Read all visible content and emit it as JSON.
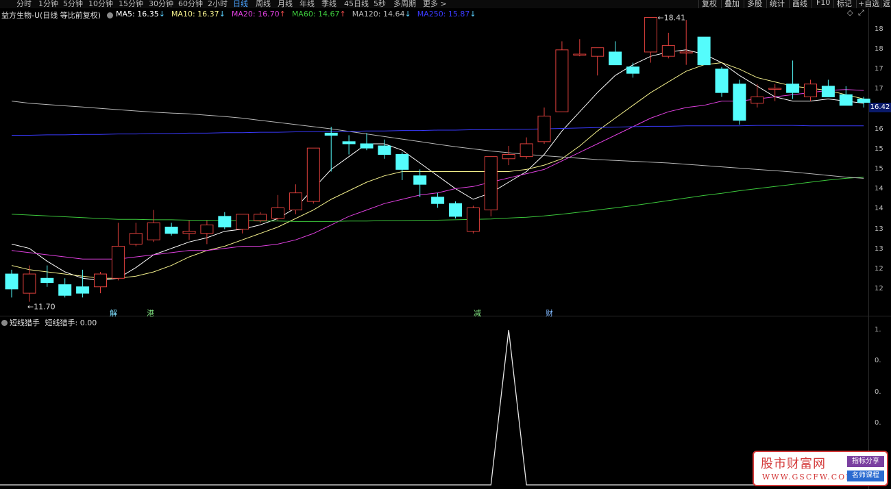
{
  "toolbar": {
    "periods": [
      "分时",
      "1分钟",
      "5分钟",
      "10分钟",
      "15分钟",
      "30分钟",
      "60分钟",
      "2小时",
      "日线",
      "周线",
      "月线",
      "年线",
      "季线",
      "45日线",
      "5秒",
      "多周期",
      "更多 >"
    ],
    "active_period": "日线",
    "right_buttons": [
      "复权",
      "叠加",
      "多股",
      "统计",
      "画线",
      "F10",
      "标记",
      "+自选",
      "返"
    ]
  },
  "main_legend": {
    "title": "益方生物-U(日线 等比前复权)",
    "items": [
      {
        "label": "MA5: 16.35",
        "arrow": "↓",
        "color": "#ffffff"
      },
      {
        "label": "MA10: 16.37",
        "arrow": "↓",
        "color": "#f4f08c"
      },
      {
        "label": "MA20: 16.70",
        "arrow": "↑",
        "color": "#e040e0"
      },
      {
        "label": "MA60: 14.67",
        "arrow": "↑",
        "color": "#3cc83c"
      },
      {
        "label": "MA120: 14.64",
        "arrow": "↓",
        "color": "#b8b8b8"
      },
      {
        "label": "MA250: 15.87",
        "arrow": "↓",
        "color": "#3a3aff"
      }
    ]
  },
  "sub_legend": {
    "title": "短线猎手",
    "value_label": "短线猎手: 0.00"
  },
  "price_axis_labels": [
    "18",
    "18",
    "17",
    "17",
    "16",
    "16",
    "15",
    "15",
    "14",
    "14",
    "13",
    "13",
    "12",
    "12"
  ],
  "sub_axis_labels": [
    "1.",
    "0.",
    "0.",
    "0."
  ],
  "current_price": "16.42",
  "events": [
    {
      "text": "解",
      "color": "#7fe0ff"
    },
    {
      "text": "港",
      "color": "#7fe07f"
    },
    {
      "text": "减",
      "color": "#7fe07f"
    },
    {
      "text": "财",
      "color": "#7fb8ff"
    }
  ],
  "watermark": {
    "title": "股市财富网",
    "url": "WWW.GSCFW.COM",
    "badge1": "指标分享",
    "badge2": "名师课程"
  },
  "chart_data": {
    "type": "candlestick",
    "ylim": [
      11.5,
      18.5
    ],
    "high_label": "18.41",
    "low_label": "11.70",
    "candles": [
      {
        "o": 12.4,
        "h": 12.5,
        "l": 11.85,
        "c": 12.05
      },
      {
        "o": 11.95,
        "h": 12.6,
        "l": 11.75,
        "c": 12.4
      },
      {
        "o": 12.3,
        "h": 12.6,
        "l": 12.1,
        "c": 12.2
      },
      {
        "o": 12.15,
        "h": 12.3,
        "l": 11.85,
        "c": 11.9
      },
      {
        "o": 12.1,
        "h": 12.5,
        "l": 11.85,
        "c": 11.95
      },
      {
        "o": 12.1,
        "h": 12.45,
        "l": 11.95,
        "c": 12.4
      },
      {
        "o": 12.3,
        "h": 13.6,
        "l": 12.25,
        "c": 13.05
      },
      {
        "o": 13.1,
        "h": 13.6,
        "l": 13.05,
        "c": 13.35
      },
      {
        "o": 13.2,
        "h": 13.9,
        "l": 13.15,
        "c": 13.6
      },
      {
        "o": 13.5,
        "h": 13.6,
        "l": 13.3,
        "c": 13.35
      },
      {
        "o": 13.35,
        "h": 13.65,
        "l": 13.2,
        "c": 13.4
      },
      {
        "o": 13.35,
        "h": 13.65,
        "l": 13.1,
        "c": 13.55
      },
      {
        "o": 13.75,
        "h": 13.85,
        "l": 13.45,
        "c": 13.5
      },
      {
        "o": 13.45,
        "h": 13.8,
        "l": 13.35,
        "c": 13.8
      },
      {
        "o": 13.65,
        "h": 13.85,
        "l": 13.6,
        "c": 13.8
      },
      {
        "o": 13.7,
        "h": 14.25,
        "l": 13.65,
        "c": 13.95
      },
      {
        "o": 13.9,
        "h": 14.5,
        "l": 13.8,
        "c": 14.3
      },
      {
        "o": 14.1,
        "h": 15.1,
        "l": 14.05,
        "c": 15.35
      },
      {
        "o": 15.7,
        "h": 15.85,
        "l": 14.8,
        "c": 15.65
      },
      {
        "o": 15.5,
        "h": 15.65,
        "l": 15.2,
        "c": 15.45
      },
      {
        "o": 15.45,
        "h": 15.7,
        "l": 15.3,
        "c": 15.35
      },
      {
        "o": 15.4,
        "h": 15.55,
        "l": 15.1,
        "c": 15.2
      },
      {
        "o": 15.2,
        "h": 15.25,
        "l": 14.6,
        "c": 14.85
      },
      {
        "o": 14.7,
        "h": 14.85,
        "l": 14.2,
        "c": 14.5
      },
      {
        "o": 14.2,
        "h": 14.3,
        "l": 13.95,
        "c": 14.05
      },
      {
        "o": 14.05,
        "h": 14.1,
        "l": 13.7,
        "c": 13.75
      },
      {
        "o": 13.4,
        "h": 14.0,
        "l": 13.35,
        "c": 13.95
      },
      {
        "o": 13.9,
        "h": 15.1,
        "l": 13.75,
        "c": 15.15
      },
      {
        "o": 15.1,
        "h": 15.4,
        "l": 14.95,
        "c": 15.2
      },
      {
        "o": 15.15,
        "h": 15.6,
        "l": 15.1,
        "c": 15.45
      },
      {
        "o": 15.5,
        "h": 16.3,
        "l": 15.45,
        "c": 16.1
      },
      {
        "o": 16.2,
        "h": 17.85,
        "l": 16.2,
        "c": 17.65
      },
      {
        "o": 17.55,
        "h": 17.9,
        "l": 17.5,
        "c": 17.55
      },
      {
        "o": 17.5,
        "h": 17.65,
        "l": 17.05,
        "c": 17.7
      },
      {
        "o": 17.6,
        "h": 17.85,
        "l": 17.3,
        "c": 17.3
      },
      {
        "o": 17.25,
        "h": 17.35,
        "l": 17.0,
        "c": 17.1
      },
      {
        "o": 17.6,
        "h": 18.4,
        "l": 17.35,
        "c": 18.41
      },
      {
        "o": 17.5,
        "h": 18.05,
        "l": 17.45,
        "c": 17.75
      },
      {
        "o": 17.6,
        "h": 18.35,
        "l": 17.3,
        "c": 17.6
      },
      {
        "o": 17.95,
        "h": 17.95,
        "l": 17.3,
        "c": 17.3
      },
      {
        "o": 17.2,
        "h": 17.25,
        "l": 16.55,
        "c": 16.65
      },
      {
        "o": 16.85,
        "h": 16.95,
        "l": 15.9,
        "c": 16.0
      },
      {
        "o": 16.4,
        "h": 16.85,
        "l": 16.3,
        "c": 16.55
      },
      {
        "o": 16.75,
        "h": 16.85,
        "l": 16.45,
        "c": 16.75
      },
      {
        "o": 16.85,
        "h": 17.4,
        "l": 16.5,
        "c": 16.65
      },
      {
        "o": 16.55,
        "h": 16.95,
        "l": 16.45,
        "c": 16.85
      },
      {
        "o": 16.8,
        "h": 16.95,
        "l": 16.55,
        "c": 16.55
      },
      {
        "o": 16.6,
        "h": 16.8,
        "l": 16.4,
        "c": 16.35
      },
      {
        "o": 16.5,
        "h": 16.55,
        "l": 16.3,
        "c": 16.42
      }
    ],
    "series": [
      {
        "name": "MA5",
        "color": "#ffffff",
        "values": [
          13.1,
          13.0,
          12.7,
          12.45,
          12.3,
          12.25,
          12.3,
          12.55,
          12.85,
          13.0,
          13.15,
          13.25,
          13.4,
          13.45,
          13.55,
          13.7,
          13.95,
          14.4,
          14.85,
          15.15,
          15.45,
          15.45,
          15.3,
          15.0,
          14.7,
          14.4,
          14.15,
          14.3,
          14.55,
          14.8,
          15.2,
          15.75,
          16.2,
          16.65,
          17.05,
          17.3,
          17.5,
          17.6,
          17.65,
          17.55,
          17.35,
          17.05,
          16.8,
          16.55,
          16.45,
          16.45,
          16.5,
          16.45,
          16.4
        ]
      },
      {
        "name": "MA10",
        "color": "#f4f08c",
        "values": [
          12.6,
          12.5,
          12.45,
          12.4,
          12.35,
          12.3,
          12.3,
          12.35,
          12.45,
          12.6,
          12.8,
          12.95,
          13.05,
          13.2,
          13.35,
          13.5,
          13.7,
          13.9,
          14.15,
          14.35,
          14.55,
          14.7,
          14.8,
          14.8,
          14.8,
          14.8,
          14.8,
          14.8,
          14.8,
          14.85,
          14.95,
          15.1,
          15.4,
          15.75,
          16.05,
          16.35,
          16.65,
          16.9,
          17.15,
          17.3,
          17.35,
          17.2,
          17.0,
          16.9,
          16.8,
          16.75,
          16.7,
          16.6,
          16.5
        ]
      },
      {
        "name": "MA20",
        "color": "#e040e0",
        "values": [
          12.95,
          12.9,
          12.85,
          12.8,
          12.75,
          12.75,
          12.75,
          12.8,
          12.85,
          12.9,
          12.95,
          12.95,
          13.0,
          13.05,
          13.05,
          13.1,
          13.2,
          13.35,
          13.55,
          13.75,
          13.9,
          14.05,
          14.15,
          14.25,
          14.3,
          14.4,
          14.45,
          14.55,
          14.65,
          14.75,
          14.85,
          15.05,
          15.25,
          15.45,
          15.65,
          15.85,
          16.05,
          16.2,
          16.3,
          16.35,
          16.45,
          16.45,
          16.5,
          16.55,
          16.6,
          16.65,
          16.7,
          16.72,
          16.7
        ]
      },
      {
        "name": "MA60",
        "color": "#3cc83c",
        "values": [
          13.8,
          13.78,
          13.76,
          13.74,
          13.72,
          13.7,
          13.68,
          13.68,
          13.67,
          13.67,
          13.66,
          13.66,
          13.65,
          13.65,
          13.64,
          13.64,
          13.63,
          13.63,
          13.63,
          13.64,
          13.64,
          13.65,
          13.65,
          13.66,
          13.66,
          13.67,
          13.68,
          13.69,
          13.71,
          13.73,
          13.76,
          13.8,
          13.85,
          13.9,
          13.95,
          14.0,
          14.06,
          14.12,
          14.18,
          14.24,
          14.29,
          14.35,
          14.4,
          14.45,
          14.5,
          14.55,
          14.6,
          14.64,
          14.67
        ]
      },
      {
        "name": "MA120",
        "color": "#b8b8b8",
        "values": [
          16.45,
          16.4,
          16.37,
          16.34,
          16.31,
          16.28,
          16.25,
          16.22,
          16.19,
          16.17,
          16.15,
          16.12,
          16.09,
          16.05,
          16.0,
          15.95,
          15.9,
          15.85,
          15.8,
          15.74,
          15.68,
          15.62,
          15.56,
          15.5,
          15.44,
          15.38,
          15.33,
          15.28,
          15.24,
          15.2,
          15.17,
          15.14,
          15.11,
          15.08,
          15.06,
          15.04,
          15.02,
          15.0,
          14.97,
          14.94,
          14.91,
          14.88,
          14.85,
          14.82,
          14.79,
          14.75,
          14.71,
          14.67,
          14.64
        ]
      },
      {
        "name": "MA250",
        "color": "#3a3aff",
        "values": [
          15.65,
          15.65,
          15.66,
          15.66,
          15.67,
          15.67,
          15.68,
          15.68,
          15.69,
          15.69,
          15.7,
          15.7,
          15.71,
          15.71,
          15.72,
          15.72,
          15.73,
          15.73,
          15.74,
          15.74,
          15.75,
          15.75,
          15.76,
          15.76,
          15.77,
          15.77,
          15.78,
          15.78,
          15.79,
          15.79,
          15.8,
          15.81,
          15.82,
          15.83,
          15.84,
          15.85,
          15.86,
          15.86,
          15.87,
          15.87,
          15.87,
          15.87,
          15.88,
          15.88,
          15.88,
          15.87,
          15.87,
          15.87,
          15.87
        ]
      }
    ],
    "indicator": {
      "name": "短线猎手",
      "ylim": [
        0,
        1
      ],
      "values": [
        0,
        0,
        0,
        0,
        0,
        0,
        0,
        0,
        0,
        0,
        0,
        0,
        0,
        0,
        0,
        0,
        0,
        0,
        0,
        0,
        0,
        0,
        0,
        0,
        0,
        0,
        0,
        0,
        1,
        0,
        0,
        0,
        0,
        0,
        0,
        0,
        0,
        0,
        0,
        0,
        0,
        0,
        0,
        0,
        0,
        0,
        0,
        0,
        0
      ]
    }
  }
}
